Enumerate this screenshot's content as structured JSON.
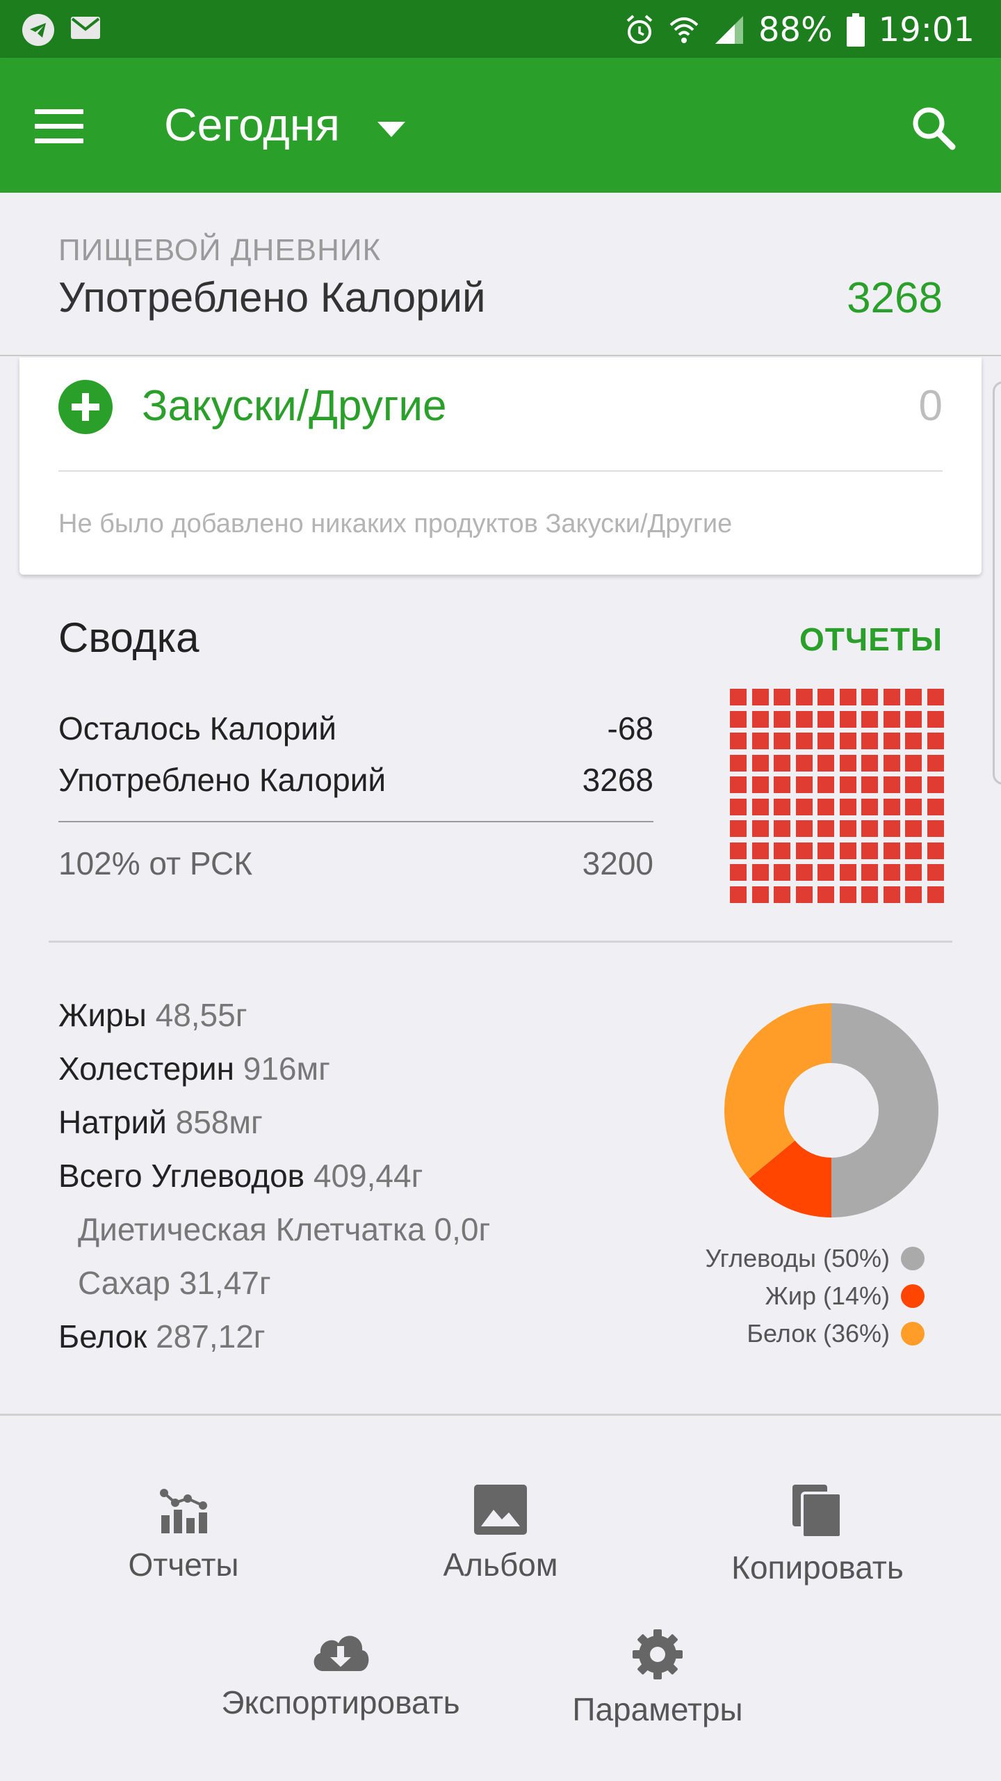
{
  "status_bar": {
    "battery": "88%",
    "time": "19:01",
    "icons": [
      "telegram-icon",
      "mail-icon",
      "alarm-icon",
      "wifi-icon",
      "signal-icon",
      "battery-icon"
    ]
  },
  "app_bar": {
    "title": "Сегодня",
    "icons": [
      "menu-icon",
      "dropdown-caret-icon",
      "search-icon"
    ]
  },
  "diary": {
    "section_label": "ПИЩЕВОЙ ДНЕВНИК",
    "title": "Употреблено Калорий",
    "value": "3268"
  },
  "meal": {
    "name": "Закуски/Другие",
    "calories": "0",
    "empty_text": "Не было добавлено никаких продуктов Закуски/Другие"
  },
  "summary": {
    "title": "Сводка",
    "reports_link": "ОТЧЕТЫ",
    "rows": [
      {
        "label": "Осталось Калорий",
        "value": "-68"
      },
      {
        "label": "Употреблено Калорий",
        "value": "3268"
      }
    ],
    "rsk": {
      "label": "102% от РСК",
      "value": "3200"
    },
    "grid_progress_percent": 102,
    "grid_color": "#e03c31"
  },
  "nutrients": [
    {
      "label": "Жиры",
      "value": "48,55г",
      "indent": false
    },
    {
      "label": "Холестерин",
      "value": "916мг",
      "indent": false
    },
    {
      "label": "Натрий",
      "value": "858мг",
      "indent": false
    },
    {
      "label": "Всего Углеводов",
      "value": "409,44г",
      "indent": false
    },
    {
      "label": "Диетическая Клетчатка",
      "value": "0,0г",
      "indent": true
    },
    {
      "label": "Сахар",
      "value": "31,47г",
      "indent": true
    },
    {
      "label": "Белок",
      "value": "287,12г",
      "indent": false
    }
  ],
  "macros": [
    {
      "label": "Углеводы (50%)",
      "percent": 50,
      "color": "#aaaaaa"
    },
    {
      "label": "Жир (14%)",
      "percent": 14,
      "color": "#ff4500"
    },
    {
      "label": "Белок (36%)",
      "percent": 36,
      "color": "#ff9d28"
    }
  ],
  "actions": [
    {
      "label": "Отчеты",
      "icon": "reports-chart-icon"
    },
    {
      "label": "Альбом",
      "icon": "image-icon"
    },
    {
      "label": "Копировать",
      "icon": "copy-icon"
    },
    {
      "label": "Экспортировать",
      "icon": "cloud-download-icon"
    },
    {
      "label": "Параметры",
      "icon": "gear-icon"
    }
  ]
}
